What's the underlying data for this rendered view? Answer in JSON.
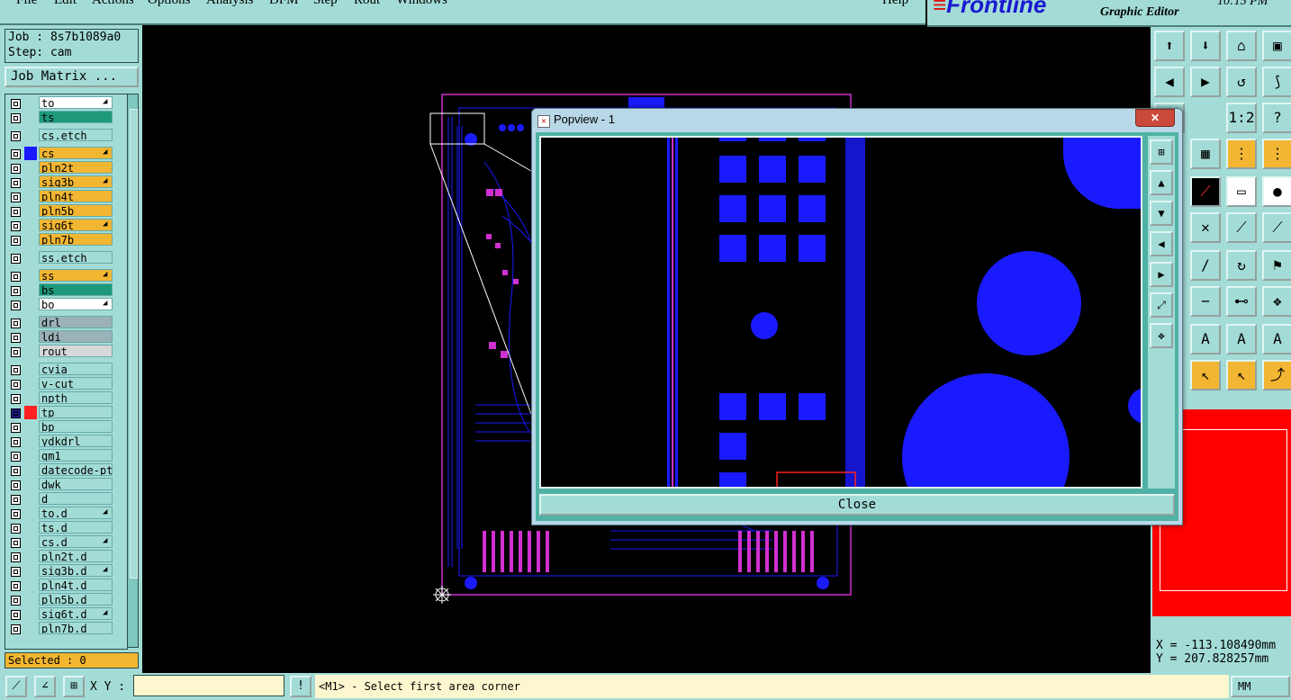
{
  "menu": {
    "items": [
      "File",
      "Edit",
      "Actions",
      "Options",
      "Analysis",
      "DFM",
      "Step",
      "Rout",
      "Windows"
    ],
    "help": "Help"
  },
  "brand": {
    "logo": "Frontline",
    "subtitle": "Graphic Editor",
    "clock": "10:15 PM"
  },
  "job": {
    "job_line": "Job : 8s7b1089a0",
    "step_line": "Step: cam",
    "matrix_button": "Job Matrix ..."
  },
  "layers": [
    {
      "name": "to",
      "color": "#ffffff",
      "editable": true
    },
    {
      "name": "ts",
      "color": "#1e9a7a",
      "editable": false
    },
    {
      "name": "cs.etch",
      "color": "#a3dcd6",
      "editable": false
    },
    {
      "name": "cs",
      "color": "#f2b632",
      "editable": true,
      "swatch": "#1a1aff"
    },
    {
      "name": "pln2t",
      "color": "#f2b632",
      "editable": false
    },
    {
      "name": "sig3b",
      "color": "#f2b632",
      "editable": true
    },
    {
      "name": "pln4t",
      "color": "#f2b632",
      "editable": false
    },
    {
      "name": "pln5b",
      "color": "#f2b632",
      "editable": false
    },
    {
      "name": "sig6t",
      "color": "#f2b632",
      "editable": true
    },
    {
      "name": "pln7b",
      "color": "#f2b632",
      "editable": false
    },
    {
      "name": "ss.etch",
      "color": "#a3dcd6",
      "editable": false
    },
    {
      "name": "ss",
      "color": "#f2b632",
      "editable": true
    },
    {
      "name": "bs",
      "color": "#1e9a7a",
      "editable": false
    },
    {
      "name": "bo",
      "color": "#ffffff",
      "editable": true
    },
    {
      "name": "drl",
      "color": "#9ab2b8",
      "editable": false
    },
    {
      "name": "ldi",
      "color": "#9ab2b8",
      "editable": false
    },
    {
      "name": "rout",
      "color": "#d8d8d8",
      "editable": false
    },
    {
      "name": "cvia",
      "color": "#a3dcd6",
      "editable": false
    },
    {
      "name": "v-cut",
      "color": "#a3dcd6",
      "editable": false
    },
    {
      "name": "npth",
      "color": "#a3dcd6",
      "editable": false
    },
    {
      "name": "tp",
      "color": "#a3dcd6",
      "editable": false,
      "swatch": "#ff2020",
      "active": true
    },
    {
      "name": "bp",
      "color": "#a3dcd6",
      "editable": false
    },
    {
      "name": "ydkdrl",
      "color": "#a3dcd6",
      "editable": false
    },
    {
      "name": "gm1",
      "color": "#a3dcd6",
      "editable": false
    },
    {
      "name": "datecode-pte",
      "color": "#a3dcd6",
      "editable": false
    },
    {
      "name": "dwk",
      "color": "#a3dcd6",
      "editable": false
    },
    {
      "name": "d",
      "color": "#a3dcd6",
      "editable": false
    },
    {
      "name": "to.d",
      "color": "#a3dcd6",
      "editable": true
    },
    {
      "name": "ts.d",
      "color": "#a3dcd6",
      "editable": false
    },
    {
      "name": "cs.d",
      "color": "#a3dcd6",
      "editable": true
    },
    {
      "name": "pln2t.d",
      "color": "#a3dcd6",
      "editable": false
    },
    {
      "name": "sig3b.d",
      "color": "#a3dcd6",
      "editable": true
    },
    {
      "name": "pln4t.d",
      "color": "#a3dcd6",
      "editable": false
    },
    {
      "name": "pln5b.d",
      "color": "#a3dcd6",
      "editable": false
    },
    {
      "name": "sig6t.d",
      "color": "#a3dcd6",
      "editable": true
    },
    {
      "name": "pln7b.d",
      "color": "#a3dcd6",
      "editable": false
    }
  ],
  "status": {
    "selected": "Selected : 0",
    "xy_label": "X Y :",
    "xy_value": "",
    "prompt": "<M1> - Select first area corner",
    "units": "MM",
    "coord_x": "X = -113.108490mm",
    "coord_y": "Y = 207.828257mm"
  },
  "popup": {
    "title": "Popview - 1",
    "close_label": "Close"
  },
  "colors": {
    "panel": "#a3dcd6",
    "highlight": "#f2b632",
    "copper": "#1a1aff",
    "silk": "#d030d0",
    "outline": "#ff0000"
  }
}
